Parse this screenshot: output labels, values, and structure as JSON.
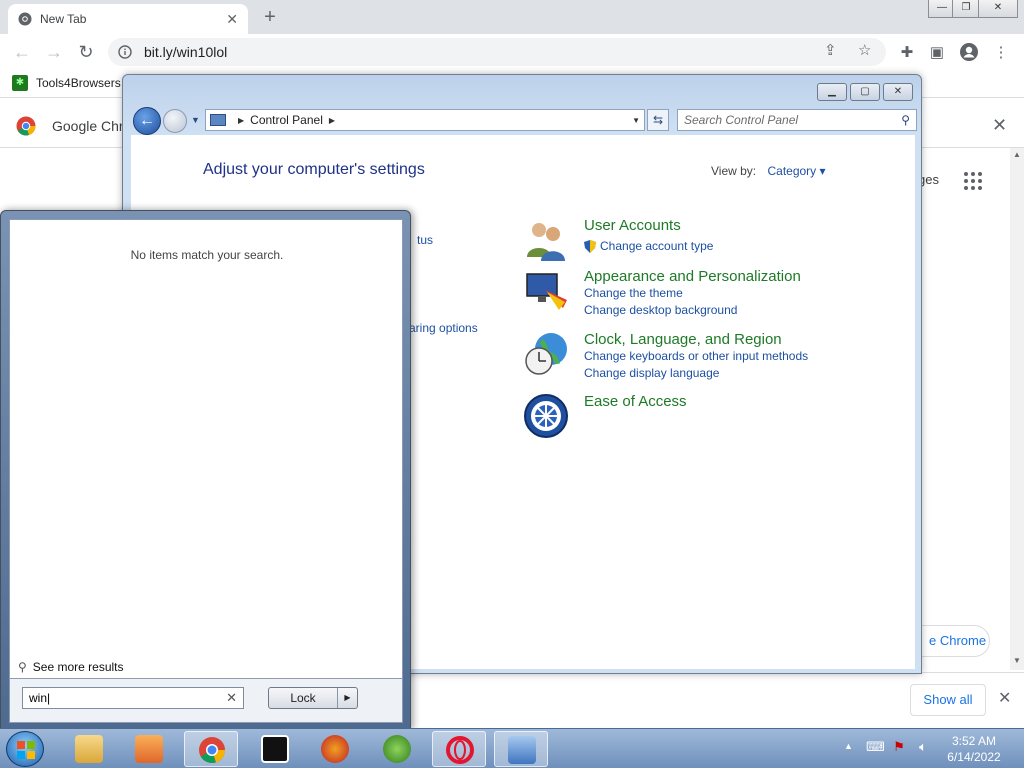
{
  "browser": {
    "tab_title": "New Tab",
    "tab_close": "✕",
    "new_tab": "+",
    "caption_min": "—",
    "caption_max": "❐",
    "caption_close": "✕",
    "url": "bit.ly/win10lol",
    "bookmark_label": "Tools4Browsers",
    "infobar_text": "Google Chro",
    "pages_text": "ges",
    "use_chrome_text": "e Chrome",
    "show_all": "Show all"
  },
  "control_panel": {
    "breadcrumb": "Control Panel",
    "search_placeholder": "Search Control Panel",
    "heading": "Adjust your computer's settings",
    "view_by_label": "View by:",
    "view_by_value": "Category",
    "partial_links": [
      "tus",
      "aring options"
    ],
    "categories": [
      {
        "title": "User Accounts",
        "links": [
          "Change account type"
        ]
      },
      {
        "title": "Appearance and Personalization",
        "links": [
          "Change the theme",
          "Change desktop background"
        ]
      },
      {
        "title": "Clock, Language, and Region",
        "links": [
          "Change keyboards or other input methods",
          "Change display language"
        ]
      },
      {
        "title": "Ease of Access",
        "links": []
      }
    ]
  },
  "start_menu": {
    "no_items": "No items match your search.",
    "see_more": "See more results",
    "search_value": "win",
    "lock_label": "Lock"
  },
  "taskbar": {
    "time": "3:52 AM",
    "date": "6/14/2022"
  },
  "colors": {
    "cp_heading": "#1e3287",
    "cp_category": "#1e7a27",
    "cp_link": "#1e50a2",
    "taskbar": "#6f90bc"
  }
}
